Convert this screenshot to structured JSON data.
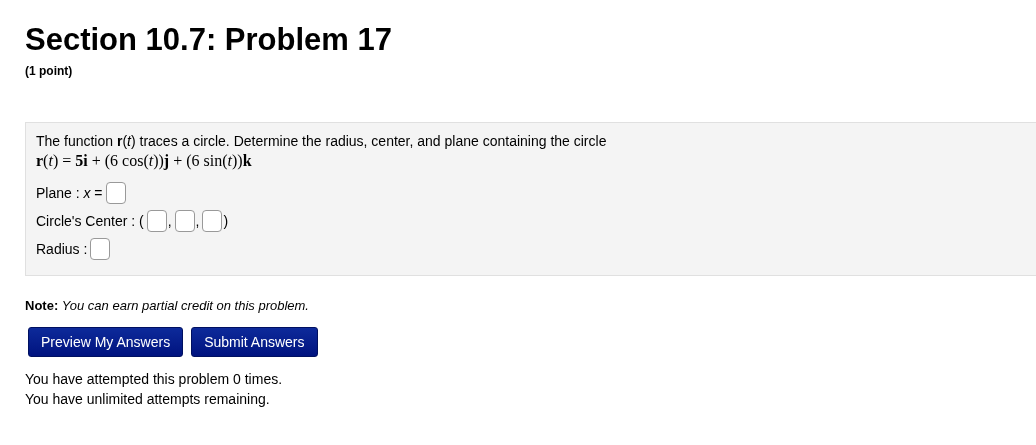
{
  "title": "Section 10.7: Problem 17",
  "points": "(1 point)",
  "problem": {
    "statement": "The function **r**(*t*) traces a circle. Determine the radius, center, and plane containing the circle",
    "formula": "**r**(*t*) = **5i** + (6 cos(*t*))**j** + (6 sin(*t*))**k**",
    "answer_rows": [
      {
        "parts": [
          {
            "kind": "text",
            "text": "Plane : *x* ="
          },
          {
            "kind": "field"
          }
        ]
      },
      {
        "parts": [
          {
            "kind": "text",
            "text": "Circle's Center : ("
          },
          {
            "kind": "field"
          },
          {
            "kind": "text",
            "text": ","
          },
          {
            "kind": "field"
          },
          {
            "kind": "text",
            "text": ","
          },
          {
            "kind": "field"
          },
          {
            "kind": "text",
            "text": ")"
          }
        ]
      },
      {
        "parts": [
          {
            "kind": "text",
            "text": "Radius :"
          },
          {
            "kind": "field"
          }
        ]
      }
    ]
  },
  "note": "**Note:** *You can earn partial credit on this problem.*",
  "buttons": [
    "Preview My Answers",
    "Submit Answers"
  ],
  "attempts": [
    "You have attempted this problem 0 times.",
    "You have unlimited attempts remaining."
  ]
}
